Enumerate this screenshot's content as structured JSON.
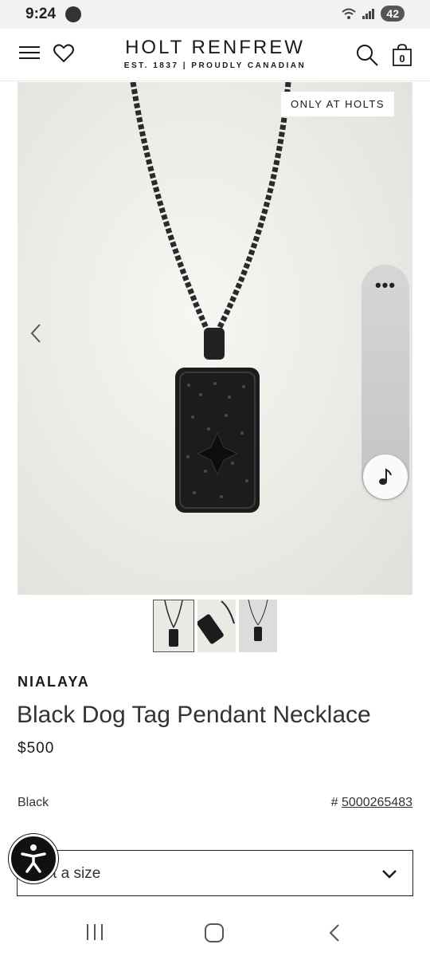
{
  "status_bar": {
    "time": "9:24",
    "battery": "42"
  },
  "header": {
    "brand_name": "HOLT RENFREW",
    "brand_tagline": "EST. 1837 | PROUDLY CANADIAN",
    "bag_count": "0"
  },
  "product_image": {
    "badge": "ONLY AT HOLTS"
  },
  "floating_widget": {
    "dots": "•••"
  },
  "product": {
    "brand": "NIALAYA",
    "name": "Black Dog Tag Pendant Necklace",
    "price": "$500",
    "color": "Black",
    "sku_prefix": "#",
    "sku": "5000265483"
  },
  "size_select": {
    "label": "ect a size"
  },
  "colors": {
    "text": "#1a1a1a",
    "image_bg": "#eceae5",
    "pendant": "#1c1c1e"
  },
  "icons": [
    "menu-icon",
    "heart-icon",
    "search-icon",
    "bag-icon",
    "chevron-left-icon",
    "music-note-icon",
    "chevron-down-icon",
    "accessibility-icon"
  ]
}
